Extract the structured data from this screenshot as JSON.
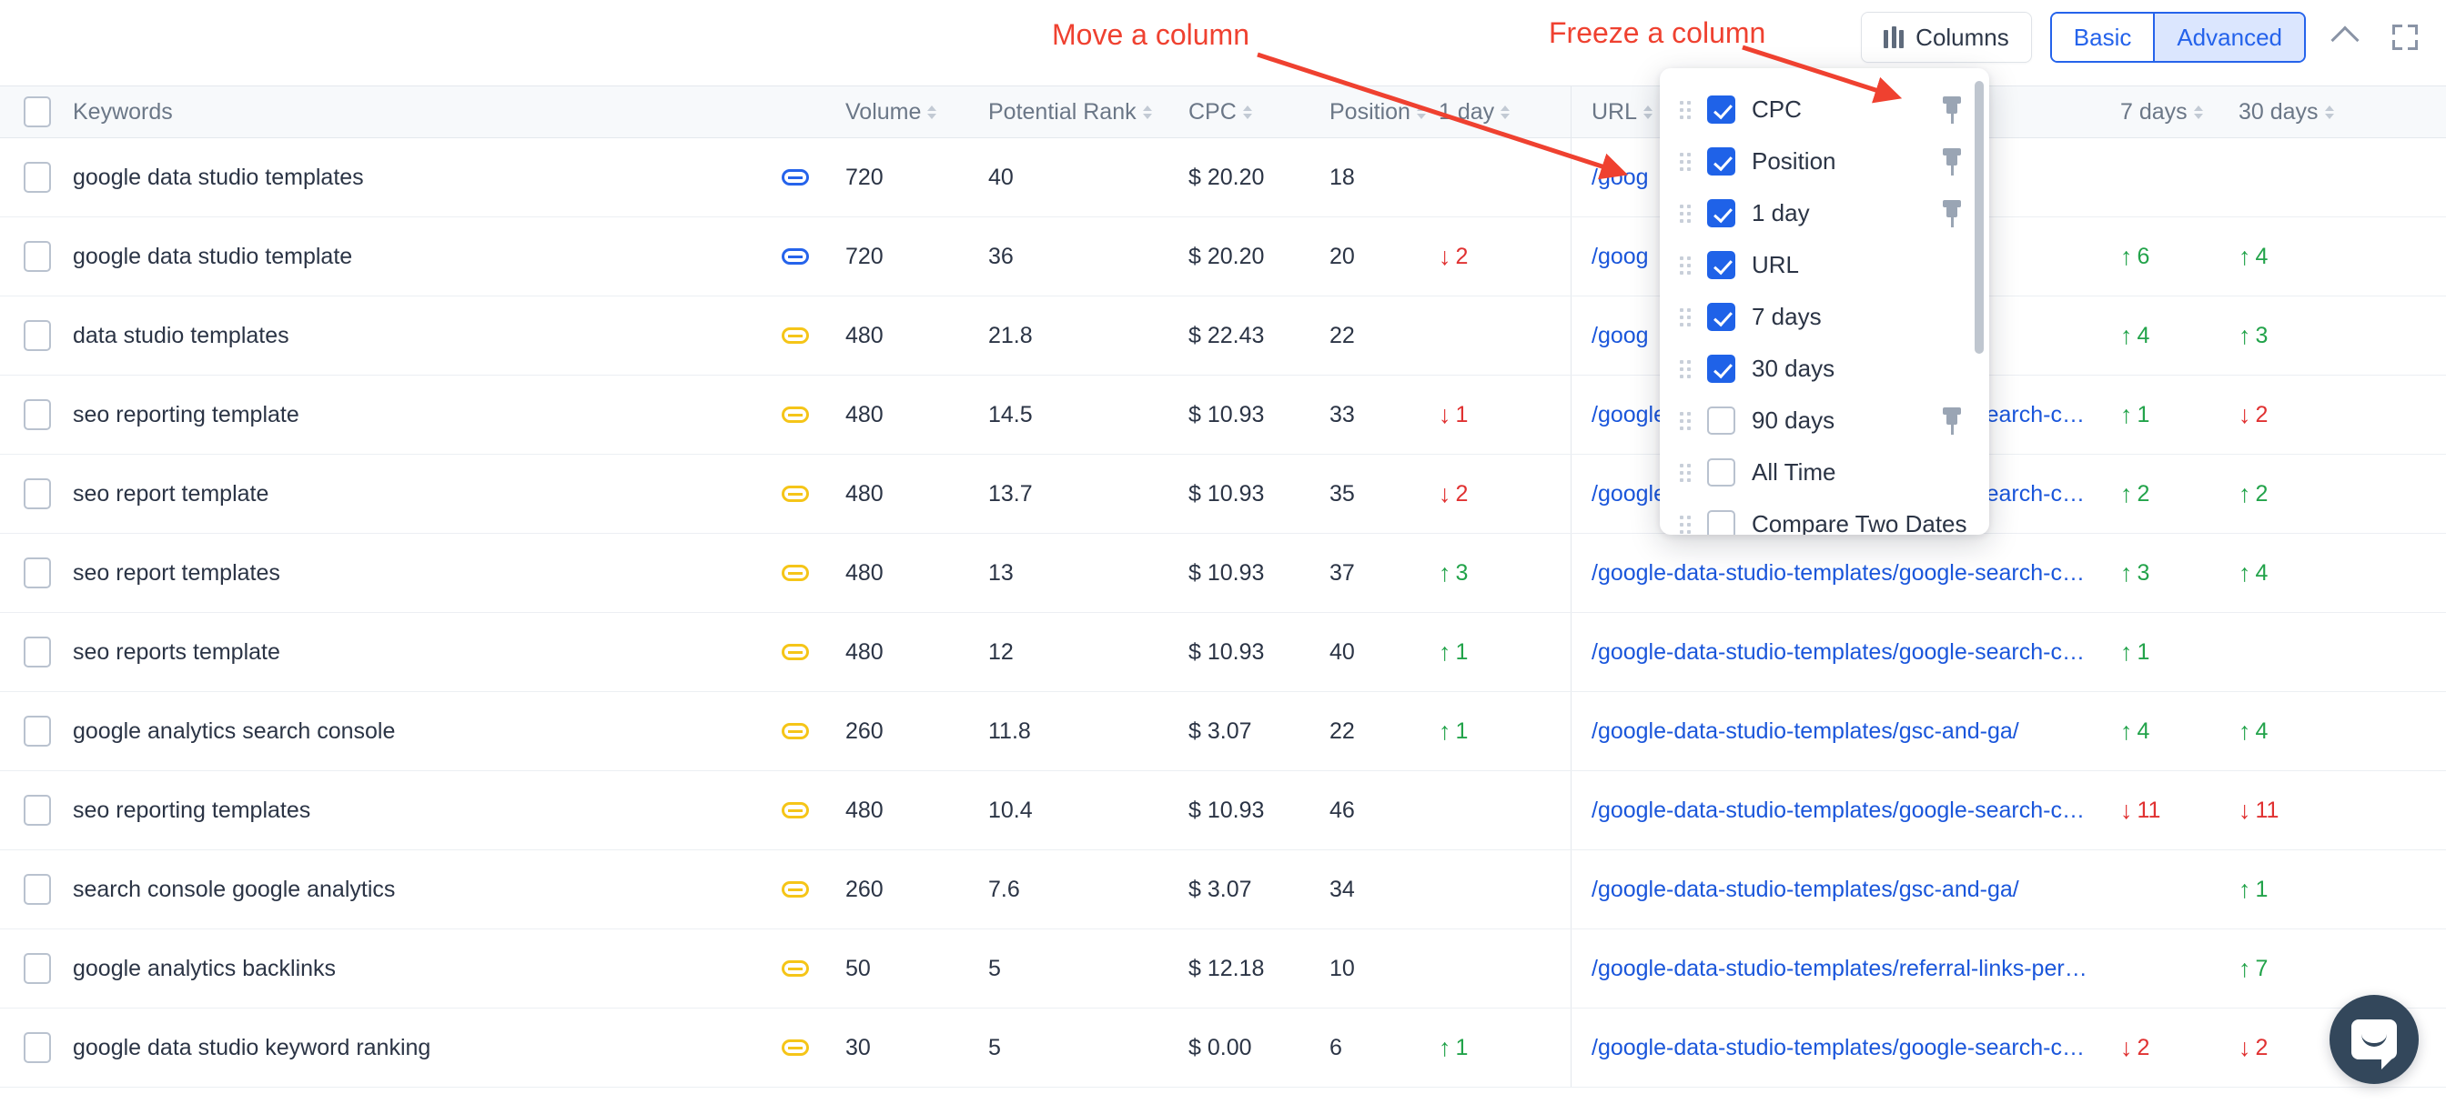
{
  "toolbar": {
    "columns_label": "Columns",
    "basic_label": "Basic",
    "advanced_label": "Advanced",
    "active_mode": "Advanced",
    "collapse_icon": "chevron-up-icon",
    "expand_icon": "fullscreen-icon"
  },
  "annotations": [
    {
      "text": "Move a column",
      "color": "#ef4130"
    },
    {
      "text": "Freeze a column",
      "color": "#ef4130"
    }
  ],
  "columns_dropdown": {
    "items": [
      {
        "label": "CPC",
        "checked": true,
        "pin": true
      },
      {
        "label": "Position",
        "checked": true,
        "pin": true
      },
      {
        "label": "1 day",
        "checked": true,
        "pin": true
      },
      {
        "label": "URL",
        "checked": true,
        "pin": false
      },
      {
        "label": "7 days",
        "checked": true,
        "pin": false
      },
      {
        "label": "30 days",
        "checked": true,
        "pin": false
      },
      {
        "label": "90 days",
        "checked": false,
        "pin": true
      },
      {
        "label": "All Time",
        "checked": false,
        "pin": false
      },
      {
        "label": "Compare Two Dates",
        "checked": false,
        "pin": false
      }
    ]
  },
  "table": {
    "headers": {
      "keywords": "Keywords",
      "volume": "Volume",
      "potential_rank": "Potential Rank",
      "cpc": "CPC",
      "position": "Position",
      "one_day": "1 day",
      "url": "URL",
      "seven_days": "7 days",
      "thirty_days": "30 days"
    },
    "rows": [
      {
        "keyword": "google data studio templates",
        "link_color": "blue",
        "volume": "720",
        "potential_rank": "40",
        "cpc": "$ 20.20",
        "position": "18",
        "d1": "",
        "d1_dir": "",
        "url": "/goog",
        "d7": "",
        "d7_dir": "",
        "d30": "",
        "d30_dir": ""
      },
      {
        "keyword": "google data studio template",
        "link_color": "blue",
        "volume": "720",
        "potential_rank": "36",
        "cpc": "$ 20.20",
        "position": "20",
        "d1": "2",
        "d1_dir": "down",
        "url": "/goog",
        "d7": "6",
        "d7_dir": "up",
        "d30": "4",
        "d30_dir": "up"
      },
      {
        "keyword": "data studio templates",
        "link_color": "gold",
        "volume": "480",
        "potential_rank": "21.8",
        "cpc": "$ 22.43",
        "position": "22",
        "d1": "",
        "d1_dir": "",
        "url": "/goog",
        "d7": "4",
        "d7_dir": "up",
        "d30": "3",
        "d30_dir": "up"
      },
      {
        "keyword": "seo reporting template",
        "link_color": "gold",
        "volume": "480",
        "potential_rank": "14.5",
        "cpc": "$ 10.93",
        "position": "33",
        "d1": "1",
        "d1_dir": "down",
        "url": "/google-data-studio-templates/google-search-co…",
        "d7": "1",
        "d7_dir": "up",
        "d30": "2",
        "d30_dir": "down"
      },
      {
        "keyword": "seo report template",
        "link_color": "gold",
        "volume": "480",
        "potential_rank": "13.7",
        "cpc": "$ 10.93",
        "position": "35",
        "d1": "2",
        "d1_dir": "down",
        "url": "/google-data-studio-templates/google-search-co…",
        "d7": "2",
        "d7_dir": "up",
        "d30": "2",
        "d30_dir": "up"
      },
      {
        "keyword": "seo report templates",
        "link_color": "gold",
        "volume": "480",
        "potential_rank": "13",
        "cpc": "$ 10.93",
        "position": "37",
        "d1": "3",
        "d1_dir": "up",
        "url": "/google-data-studio-templates/google-search-co…",
        "d7": "3",
        "d7_dir": "up",
        "d30": "4",
        "d30_dir": "up"
      },
      {
        "keyword": "seo reports template",
        "link_color": "gold",
        "volume": "480",
        "potential_rank": "12",
        "cpc": "$ 10.93",
        "position": "40",
        "d1": "1",
        "d1_dir": "up",
        "url": "/google-data-studio-templates/google-search-co…",
        "d7": "1",
        "d7_dir": "up",
        "d30": "",
        "d30_dir": ""
      },
      {
        "keyword": "google analytics search console",
        "link_color": "gold",
        "volume": "260",
        "potential_rank": "11.8",
        "cpc": "$ 3.07",
        "position": "22",
        "d1": "1",
        "d1_dir": "up",
        "url": "/google-data-studio-templates/gsc-and-ga/",
        "d7": "4",
        "d7_dir": "up",
        "d30": "4",
        "d30_dir": "up"
      },
      {
        "keyword": "seo reporting templates",
        "link_color": "gold",
        "volume": "480",
        "potential_rank": "10.4",
        "cpc": "$ 10.93",
        "position": "46",
        "d1": "",
        "d1_dir": "",
        "url": "/google-data-studio-templates/google-search-co…",
        "d7": "11",
        "d7_dir": "down",
        "d30": "11",
        "d30_dir": "down"
      },
      {
        "keyword": "search console google analytics",
        "link_color": "gold",
        "volume": "260",
        "potential_rank": "7.6",
        "cpc": "$ 3.07",
        "position": "34",
        "d1": "",
        "d1_dir": "",
        "url": "/google-data-studio-templates/gsc-and-ga/",
        "d7": "",
        "d7_dir": "",
        "d30": "1",
        "d30_dir": "up"
      },
      {
        "keyword": "google analytics backlinks",
        "link_color": "gold",
        "volume": "50",
        "potential_rank": "5",
        "cpc": "$ 12.18",
        "position": "10",
        "d1": "",
        "d1_dir": "",
        "url": "/google-data-studio-templates/referral-links-perf…",
        "d7": "",
        "d7_dir": "",
        "d30": "7",
        "d30_dir": "up"
      },
      {
        "keyword": "google data studio keyword ranking",
        "link_color": "gold",
        "volume": "30",
        "potential_rank": "5",
        "cpc": "$ 0.00",
        "position": "6",
        "d1": "1",
        "d1_dir": "up",
        "url": "/google-data-studio-templates/google-search-co…",
        "d7": "2",
        "d7_dir": "down",
        "d30": "2",
        "d30_dir": "down"
      }
    ]
  },
  "chat_widget": {
    "icon": "chat-bubble-icon",
    "color": "#33475b"
  }
}
